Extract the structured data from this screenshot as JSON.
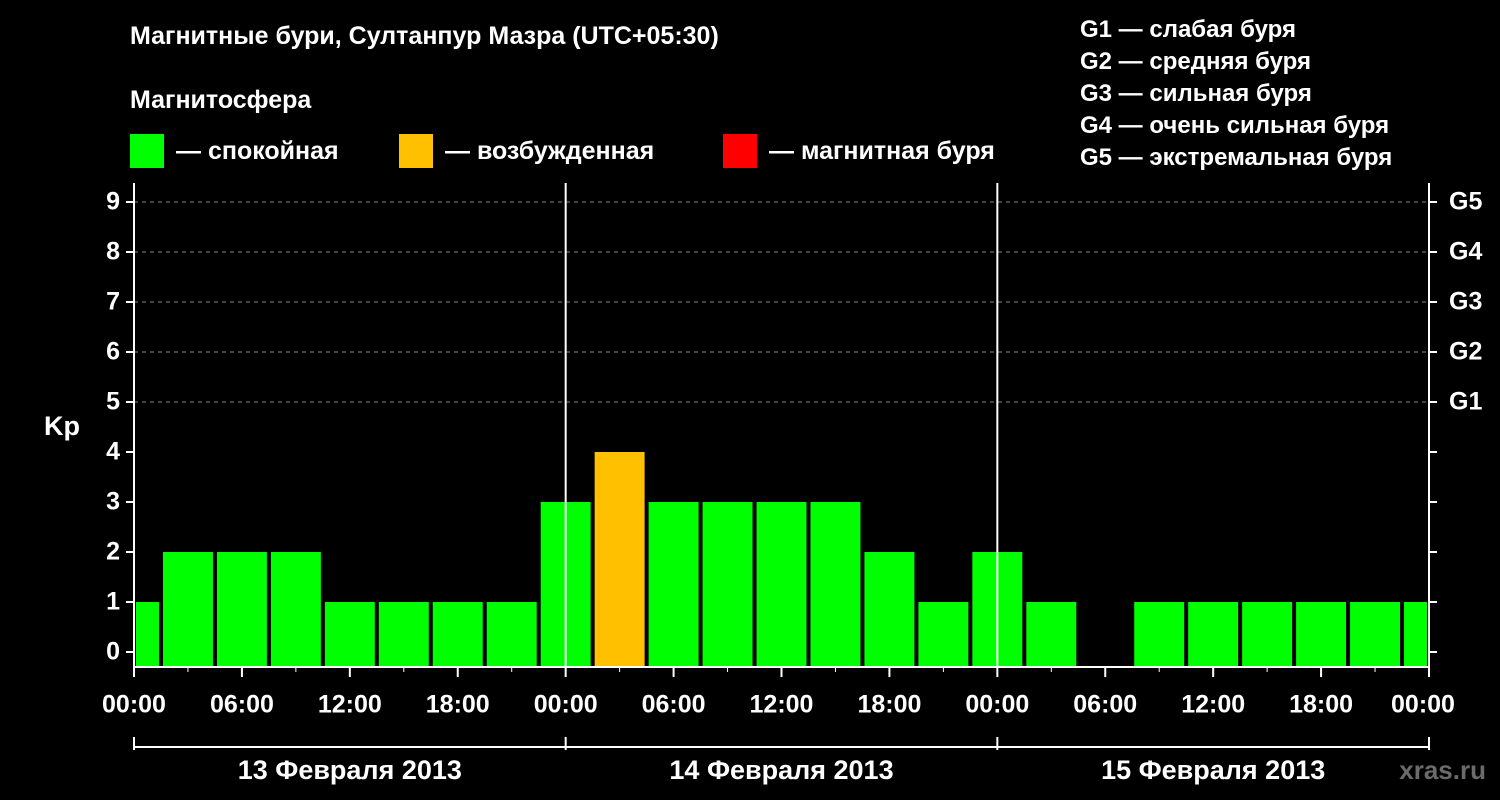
{
  "header": {
    "title": "Магнитные бури, Султанпур Мазра (UTC+05:30)",
    "subtitle": "Магнитосфера"
  },
  "legend": [
    {
      "color": "#00ff00",
      "label": "— спокойная"
    },
    {
      "color": "#ffc000",
      "label": "— возбужденная"
    },
    {
      "color": "#ff0000",
      "label": "— магнитная буря"
    }
  ],
  "g_legend": [
    "G1 — слабая буря",
    "G2 — средняя буря",
    "G3 — сильная буря",
    "G4 — очень сильная буря",
    "G5 — экстремальная буря"
  ],
  "watermark": "xras.ru",
  "chart_data": {
    "type": "bar",
    "ylabel": "Kp",
    "ylim": [
      0,
      9
    ],
    "yticks": [
      "0",
      "1",
      "2",
      "3",
      "4",
      "5",
      "6",
      "7",
      "8",
      "9"
    ],
    "right_ticks": [
      {
        "value": 5,
        "label": "G1"
      },
      {
        "value": 6,
        "label": "G2"
      },
      {
        "value": 7,
        "label": "G3"
      },
      {
        "value": 8,
        "label": "G4"
      },
      {
        "value": 9,
        "label": "G5"
      }
    ],
    "xticks": [
      "00:00",
      "06:00",
      "12:00",
      "18:00",
      "00:00",
      "06:00",
      "12:00",
      "18:00",
      "00:00",
      "06:00",
      "12:00",
      "18:00",
      "00:00"
    ],
    "days": [
      "13 Февраля 2013",
      "14 Февраля 2013",
      "15 Февраля 2013"
    ],
    "grid": "horizontal dashed at 5–9",
    "bar_hours": 3,
    "first_bar_hours": 1.5,
    "values": [
      1,
      2,
      2,
      2,
      1,
      1,
      1,
      1,
      3,
      4,
      3,
      3,
      3,
      3,
      2,
      1,
      2,
      1,
      0,
      1,
      1,
      1,
      1,
      1,
      1
    ],
    "colors": {
      "quiet": "#00ff00",
      "active": "#ffc000",
      "storm": "#ff0000"
    }
  }
}
